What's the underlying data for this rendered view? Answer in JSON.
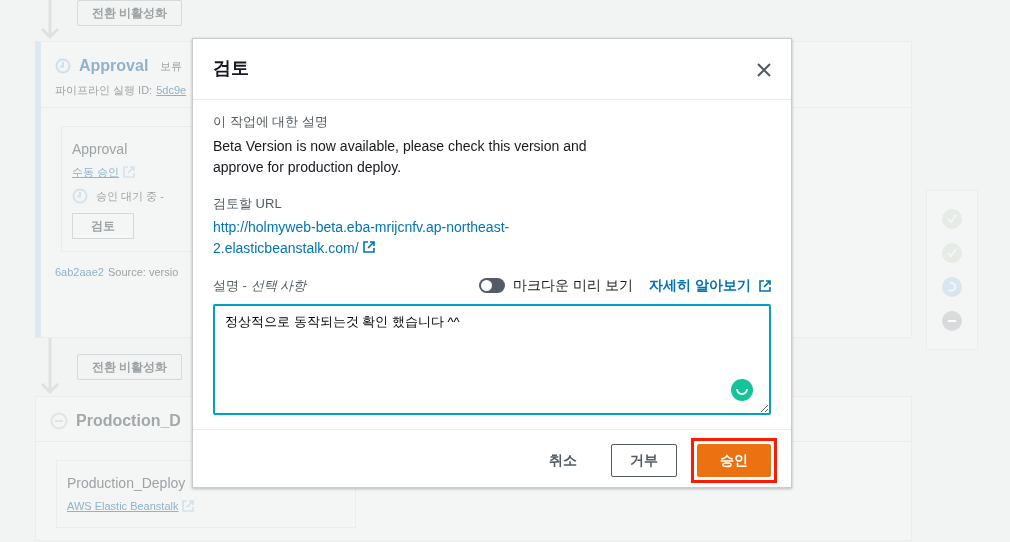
{
  "pipeline": {
    "transitions": [
      {
        "button": "전환 비활성화"
      },
      {
        "button": "전환 비활성화"
      }
    ],
    "stages": [
      {
        "kind": "pending",
        "name": "Approval",
        "status": "보류",
        "execution_label": "파이프라인 실행 ID:",
        "execution_id": "5dc9e",
        "action": {
          "name": "Approval",
          "provider": "수동 승인",
          "status": "승인 대기 중 -",
          "button": "검토"
        },
        "footer_id": "6ab2aae2",
        "footer_source": "Source: versio"
      },
      {
        "kind": "disabled",
        "name": "Prodoction_D",
        "action": {
          "name": "Production_Deploy",
          "provider": "AWS Elastic Beanstalk"
        }
      }
    ],
    "status_icons": [
      {
        "kind": "succeeded"
      },
      {
        "kind": "succeeded"
      },
      {
        "kind": "in_progress"
      },
      {
        "kind": "disabled"
      }
    ]
  },
  "dialog": {
    "title": "검토",
    "description_label": "이 작업에 대한 설명",
    "description": "Beta Version is now available, please check this version and approve for production deploy.",
    "url_label": "검토할 URL",
    "url": "http://holmyweb-beta.eba-mrijcnfv.ap-northeast-2.elasticbeanstalk.com/",
    "comment_label": "설명 - *선택 사항*",
    "markdown_preview": {
      "label": "마크다운 미리 보기",
      "on": false
    },
    "learn_more": "자세히 알아보기",
    "comment": "정상적으로 동작되는것 확인 했습니다 ^^",
    "buttons": [
      {
        "kind": "link",
        "label": "취소",
        "highlighted": false
      },
      {
        "kind": "outline",
        "label": "거부",
        "highlighted": false
      },
      {
        "kind": "primary",
        "label": "승인",
        "highlighted": true
      }
    ]
  }
}
